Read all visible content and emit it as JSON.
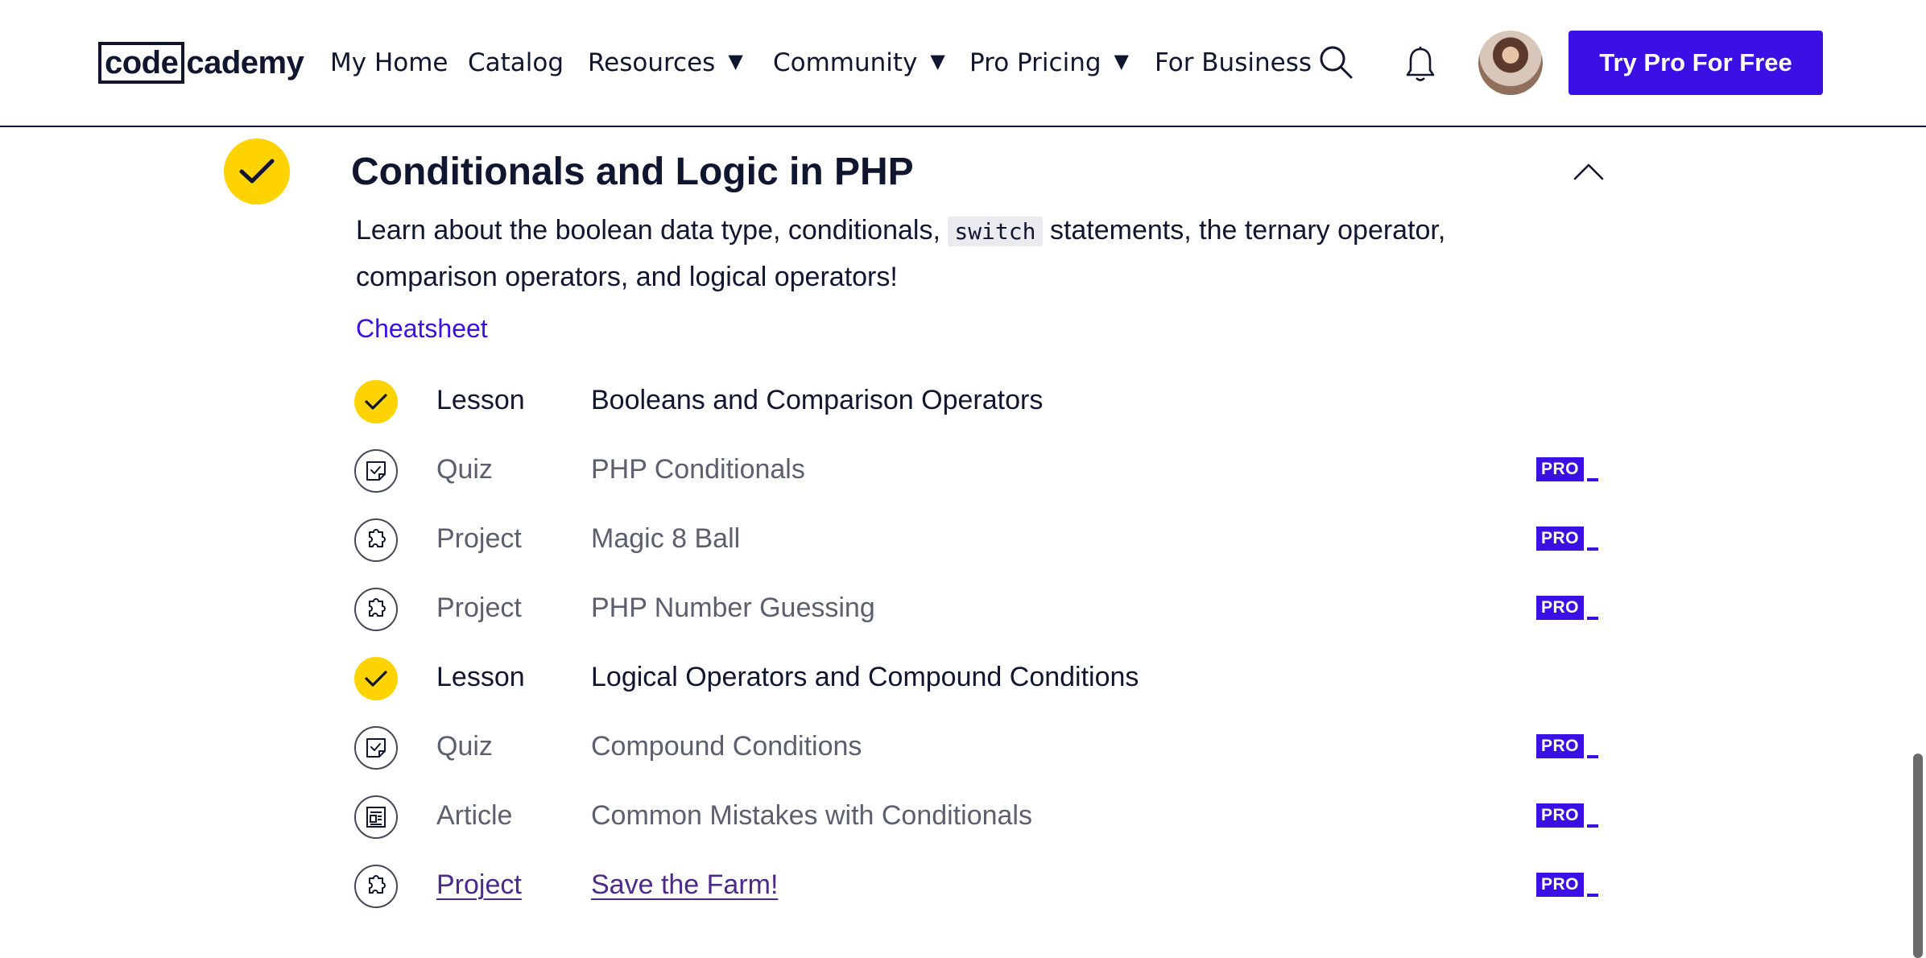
{
  "header": {
    "logo_boxed": "code",
    "logo_rest": "cademy",
    "nav": {
      "my_home": "My Home",
      "catalog": "Catalog",
      "resources": "Resources",
      "community": "Community",
      "pro_pricing": "Pro Pricing",
      "for_business": "For Business"
    },
    "cta": "Try Pro For Free",
    "icons": [
      "search-icon",
      "bell-icon",
      "avatar"
    ]
  },
  "module": {
    "status": "completed",
    "title": "Conditionals and Logic in PHP",
    "desc_before": "Learn about the boolean data type, conditionals,",
    "desc_code": "switch",
    "desc_after": "statements, the ternary operator, comparison operators, and logical operators!",
    "cheatsheet": "Cheatsheet",
    "collapse_icon": "chevron-up-icon"
  },
  "items": [
    {
      "type": "Lesson",
      "title": "Booleans and Comparison Operators",
      "completed": true,
      "pro": false,
      "icon": "check-icon"
    },
    {
      "type": "Quiz",
      "title": "PHP Conditionals",
      "completed": false,
      "pro": true,
      "icon": "quiz-icon"
    },
    {
      "type": "Project",
      "title": "Magic 8 Ball",
      "completed": false,
      "pro": true,
      "icon": "puzzle-icon"
    },
    {
      "type": "Project",
      "title": "PHP Number Guessing",
      "completed": false,
      "pro": true,
      "icon": "puzzle-icon"
    },
    {
      "type": "Lesson",
      "title": "Logical Operators and Compound Conditions",
      "completed": true,
      "pro": false,
      "icon": "check-icon"
    },
    {
      "type": "Quiz",
      "title": "Compound Conditions",
      "completed": false,
      "pro": true,
      "icon": "quiz-icon"
    },
    {
      "type": "Article",
      "title": "Common Mistakes with Conditionals",
      "completed": false,
      "pro": true,
      "icon": "article-icon"
    },
    {
      "type": "Project",
      "title": "Save the Farm!",
      "completed": false,
      "pro": true,
      "icon": "puzzle-icon",
      "hovered": true
    }
  ],
  "pro_label": "PRO",
  "colors": {
    "accent": "#3a10e5",
    "check": "#ffd300",
    "text": "#10162f",
    "muted": "#5c5f6d"
  }
}
